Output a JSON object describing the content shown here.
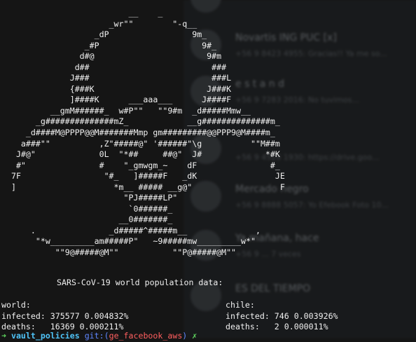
{
  "background_app": {
    "rows": [
      {
        "title": "",
        "subtitle": ""
      },
      {
        "title": "Novartis ING PUC [x]",
        "subtitle": "+56 9 8423 4955: Gracias!! Ya me so..."
      },
      {
        "title": "",
        "subtitle": ""
      },
      {
        "title": "e s t a n d",
        "subtitle": "+56 9 7283 2016: No tuvimos..."
      },
      {
        "title": "",
        "subtitle": ""
      },
      {
        "title": "",
        "subtitle": "+56 9 4528 1930: https://drive.goo..."
      },
      {
        "title": "Mercado negro",
        "subtitle": "+56 9 8888 5057: Yo Efebook Foto 10..."
      },
      {
        "title": "Ya mañana, hace",
        "subtitle": "+56 9 ... 7 veces"
      },
      {
        "title": "ES DEL TIEMPO",
        "subtitle": ""
      }
    ]
  },
  "terminal": {
    "biohazard_ascii": "                          __    _\n                      _wr\"\"        \"-q__\n                   _dP                 9m_\n                 _#P                     9#_\n                d#@                       9#m\n               d##                         ###\n              J###                         ###L\n              {###K                       J###K\n              ]####K      ___aaa___      J####F\n          __gmM######_  w#P\"\"   \"\"9#m  _d#####Mmw__\n       _g##############mZ_            __g##############m_\n     _d####M@PPPP@@M#######Mmp gm#########@@PPP9@M####m_\n    a###\"\"          ,Z\"#####@\" '######\"\\g          \"\"M##m\n   J#@\"             0L  \"*##     ##@\"  J#             *#K\n   #\"               #    \"_gmwgm_~    dF               #_\n  7F                 \"#_   ]#####F   _dK                JE\n  ]                    *m__ ##### __g@\"                  F\n                         \"PJ#####LP\"\n                          `0######_\n                        __0#######_\n      .               _d#####^#####m__              ,\n       \"*w_________am#####P\"   ~9#####mw_________w*\"\n           \"\"9@#####@M\"\"           \"\"P@#####@M\"\"",
    "report_title": "SARS-CoV-19 world population data:",
    "world": {
      "label": "world:",
      "infected_line": "infected: 375577 0.004832%",
      "deaths_line": "deaths:   16369 0.000211%"
    },
    "chile": {
      "label": "chile:",
      "infected_line": "infected: 746 0.003926%",
      "deaths_line": "deaths:   2 0.000011%"
    },
    "prompt": {
      "arrow": "➜",
      "directory": "vault_policies",
      "git_prefix": "git:(",
      "branch": "ge_facebook_aws",
      "git_suffix": ")",
      "cursor_marker": "✗"
    }
  }
}
